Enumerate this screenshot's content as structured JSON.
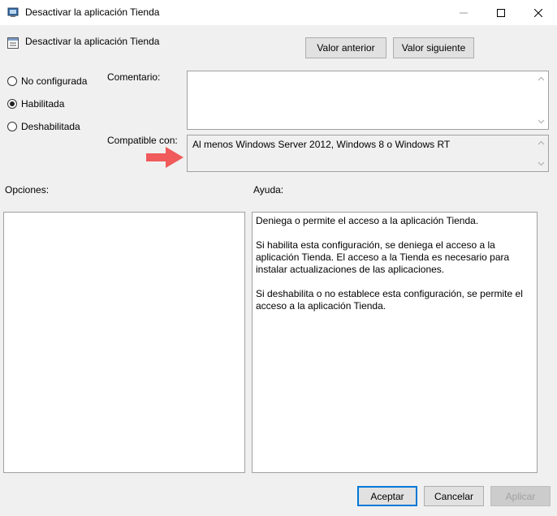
{
  "window": {
    "title": "Desactivar la aplicación Tienda"
  },
  "header": {
    "title": "Desactivar la aplicación Tienda",
    "prev_button": "Valor anterior",
    "next_button": "Valor siguiente"
  },
  "options": {
    "radios": [
      {
        "label": "No configurada",
        "checked": false
      },
      {
        "label": "Habilitada",
        "checked": true
      },
      {
        "label": "Deshabilitada",
        "checked": false
      }
    ]
  },
  "comment": {
    "label": "Comentario:",
    "value": ""
  },
  "supported": {
    "label": "Compatible con:",
    "value": "Al menos Windows Server 2012, Windows 8 o Windows RT"
  },
  "panels": {
    "options_label": "Opciones:",
    "help_label": "Ayuda:"
  },
  "help": {
    "paragraphs": [
      "Deniega o permite el acceso a la aplicación Tienda.",
      "Si habilita esta configuración, se deniega el acceso a la aplicación Tienda. El acceso a la Tienda es necesario para instalar actualizaciones de las aplicaciones.",
      "Si deshabilita o no establece esta configuración, se permite el acceso a la aplicación Tienda."
    ]
  },
  "footer": {
    "ok_button": "Aceptar",
    "cancel_button": "Cancelar",
    "apply_button": "Aplicar"
  },
  "colors": {
    "arrow": "#f05a5a",
    "default_button_border": "#0078d7"
  },
  "icons": {
    "title_icon": "policy-settings-icon",
    "header_icon": "policy-document-icon"
  }
}
